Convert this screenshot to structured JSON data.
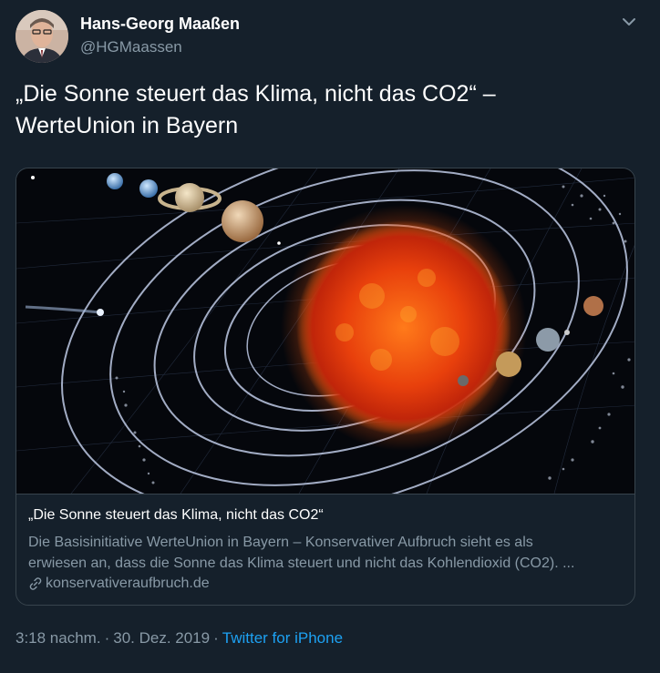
{
  "author": {
    "name": "Hans-Georg Maaßen",
    "handle": "@HGMaassen"
  },
  "tweet": {
    "text_line1": "„Die Sonne steuert das Klima, nicht das CO2“ –",
    "text_line2": "WerteUnion in Bayern"
  },
  "card": {
    "title": "„Die Sonne steuert das Klima, nicht das CO2“",
    "description_line1": "Die Basisinitiative WerteUnion in Bayern – Konservativer Aufbruch sieht es als",
    "description_line2": "erwiesen an, dass die Sonne das Klima steuert und nicht das Kohlendioxid (CO2). ...",
    "domain": "konservativeraufbruch.de"
  },
  "meta": {
    "time": "3:18 nachm.",
    "separator": "·",
    "date": "30. Dez. 2019",
    "source": "Twitter for iPhone"
  },
  "colors": {
    "background": "#15202b",
    "secondary_text": "#8899a6",
    "link": "#1da1f2",
    "border": "#38444d"
  }
}
